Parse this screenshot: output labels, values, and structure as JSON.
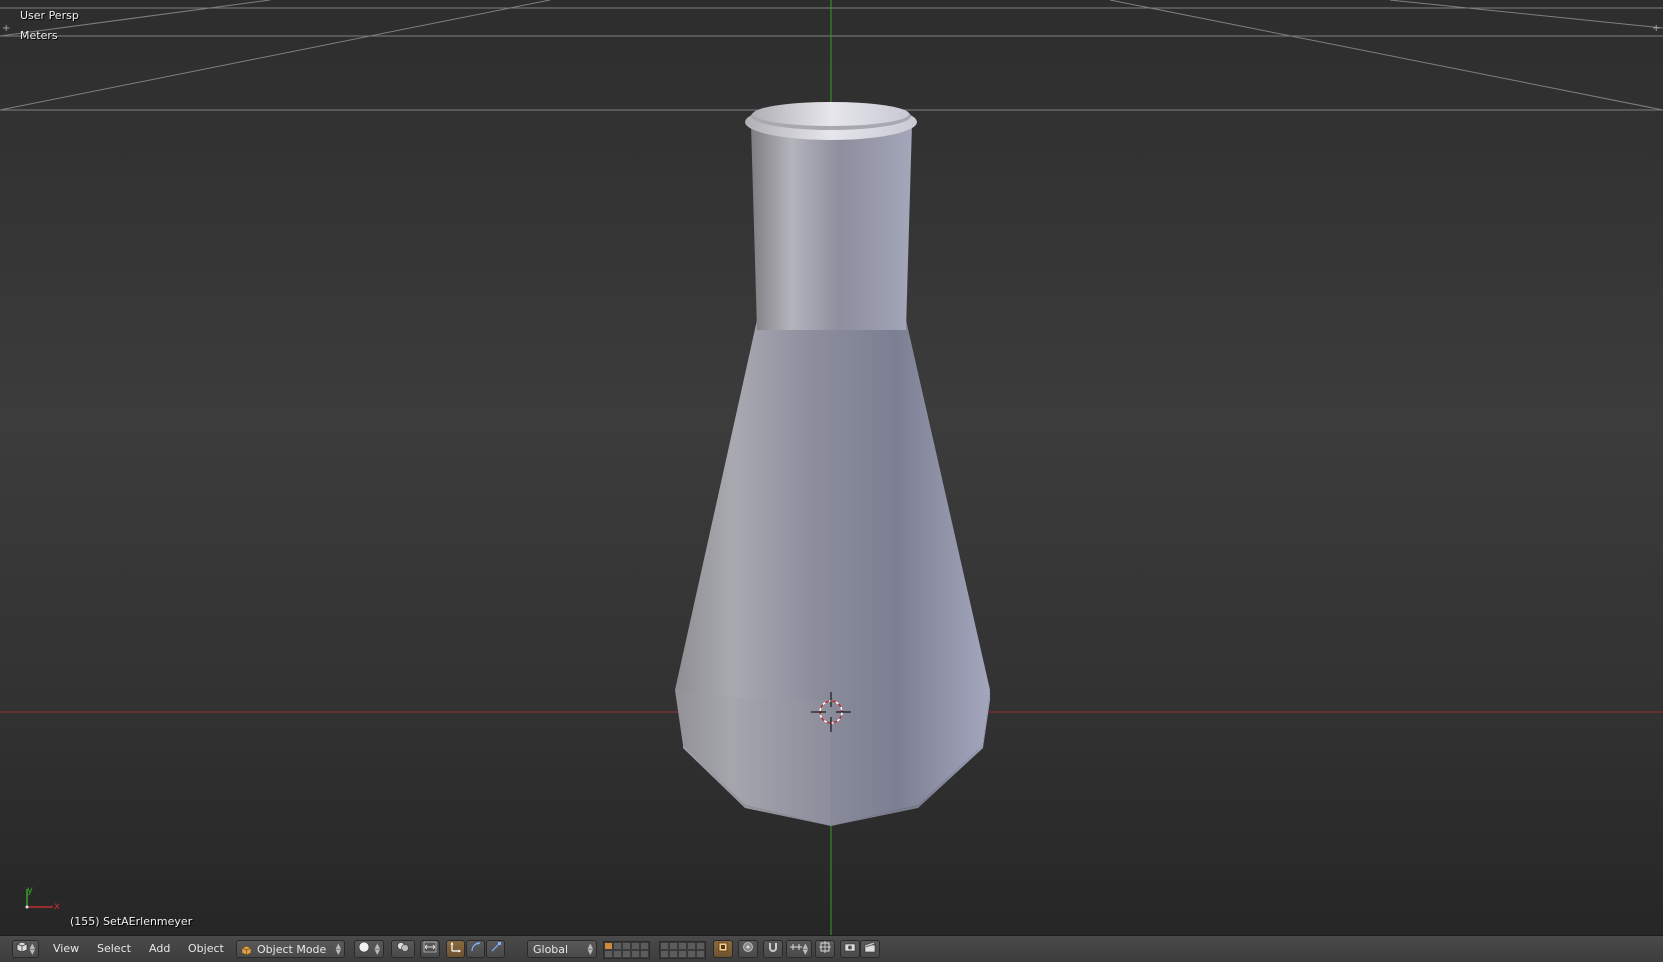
{
  "viewport": {
    "view_name": "User Persp",
    "units": "Meters",
    "object_info": "(155) SetAErlenmeyer",
    "axis_y_label": "y",
    "axis_x_label": "x"
  },
  "header": {
    "menus": {
      "view": "View",
      "select": "Select",
      "add": "Add",
      "object": "Object"
    },
    "mode": "Object Mode",
    "orientation": "Global",
    "icons": {
      "editor_type": "3d-view-icon",
      "mode": "cube-icon",
      "shading": "solid-sphere-icon",
      "pivot": "pivot-icon",
      "manipulator": "manipulator-toggle-icon",
      "translate": "translate-icon",
      "rotate": "rotate-icon",
      "scale": "scale-icon",
      "lock_layers": "lock-layers-icon",
      "proportional_edit": "proportional-edit-icon",
      "snap": "magnet-icon",
      "snap_element": "snap-element-icon",
      "snap_target": "snap-target-icon",
      "render_opengl": "camera-icon",
      "render_anim": "clapper-icon"
    }
  },
  "colors": {
    "grid_line": "#9a9a9a",
    "x_axis": "#a02a2a",
    "y_axis": "#3a9a2a",
    "mesh_light": "#d8d8e2",
    "mesh_dark": "#6c6f82",
    "active_tool": "#c9883e"
  }
}
